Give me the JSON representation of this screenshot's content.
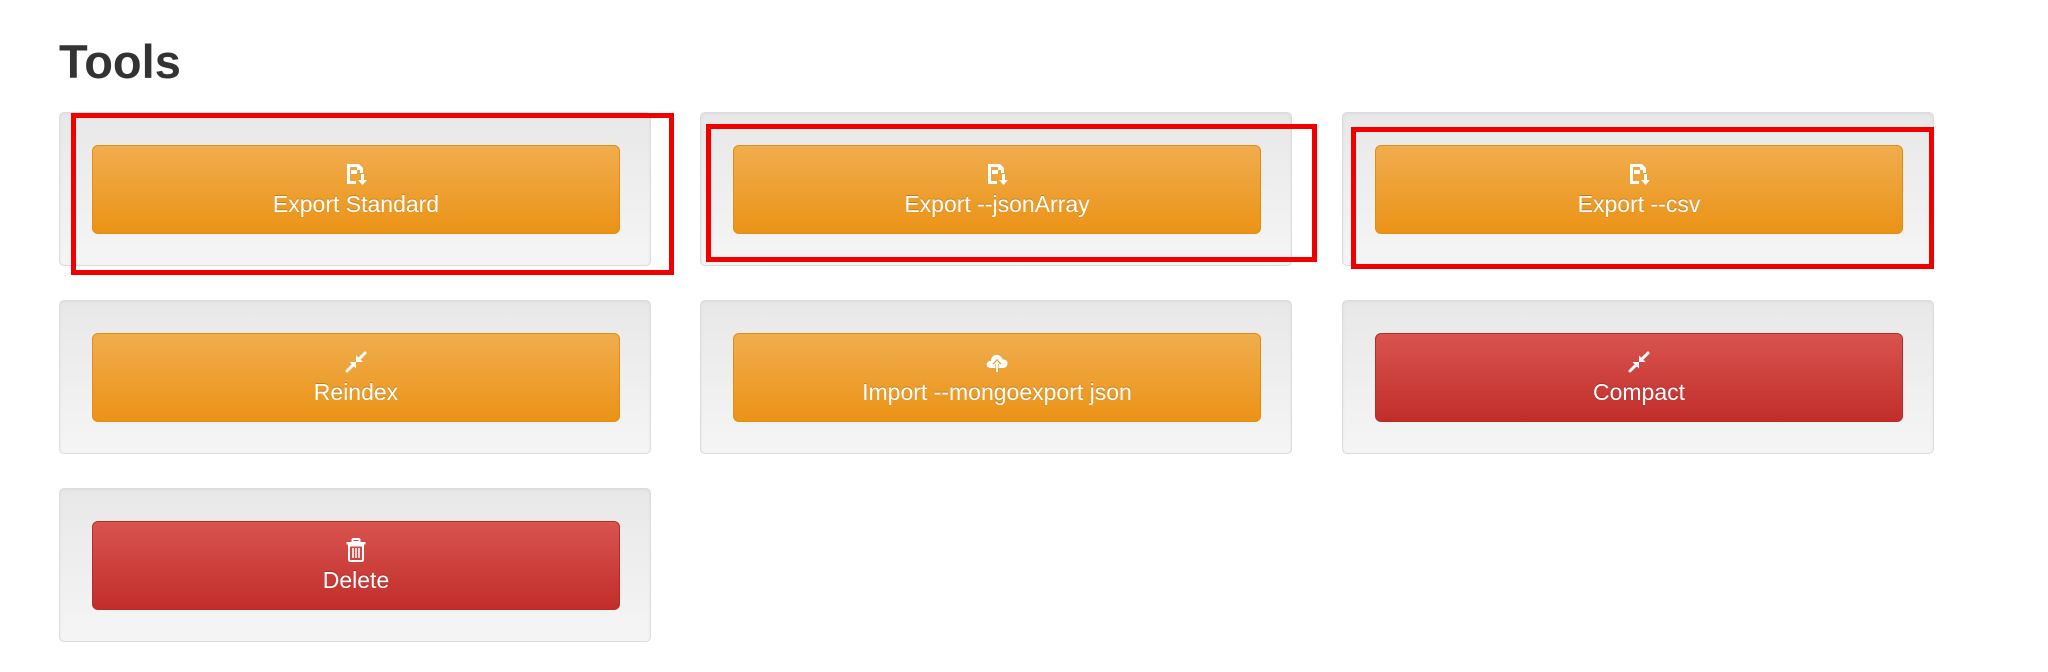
{
  "page": {
    "title": "Tools"
  },
  "tools": [
    {
      "label": "Export Standard",
      "icon": "export-file-icon",
      "variant": "warning"
    },
    {
      "label": "Export --jsonArray",
      "icon": "export-file-icon",
      "variant": "warning"
    },
    {
      "label": "Export --csv",
      "icon": "export-file-icon",
      "variant": "warning"
    },
    {
      "label": "Reindex",
      "icon": "compress-arrows-icon",
      "variant": "warning"
    },
    {
      "label": "Import --mongoexport json",
      "icon": "cloud-upload-icon",
      "variant": "warning"
    },
    {
      "label": "Compact",
      "icon": "compress-arrows-icon",
      "variant": "danger"
    },
    {
      "label": "Delete",
      "icon": "trash-icon",
      "variant": "danger"
    }
  ],
  "colors": {
    "warning": "#f0ad4e",
    "danger": "#d9534f",
    "highlight": "#f20000",
    "title": "#333333"
  }
}
